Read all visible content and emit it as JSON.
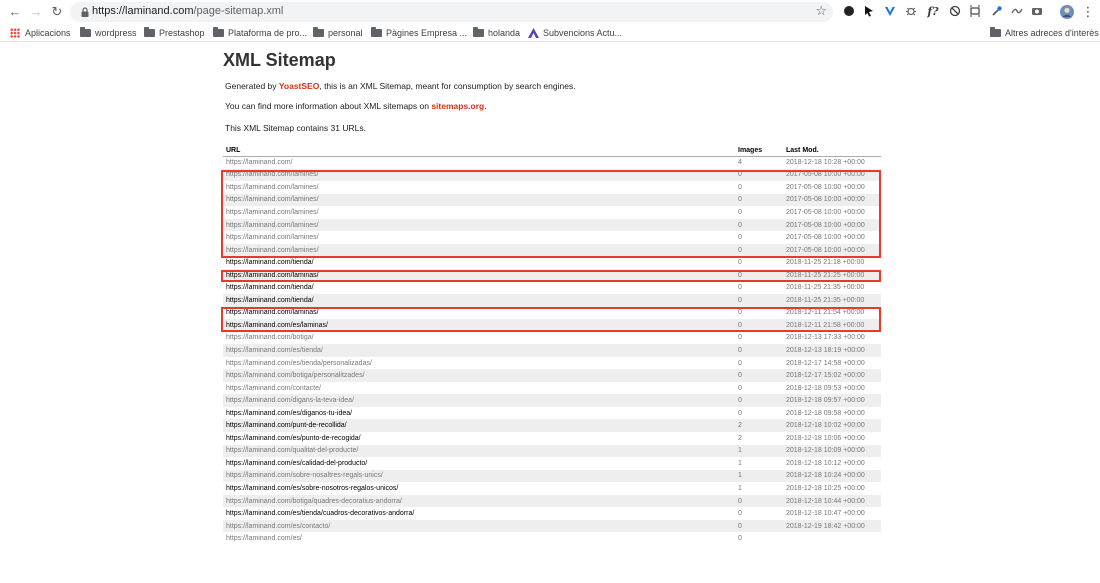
{
  "browser": {
    "url_host": "https://laminand.com",
    "url_path": "/page-sitemap.xml",
    "toolbar_icons": [
      "back-icon",
      "forward-icon",
      "reload-icon",
      "lock-icon",
      "star-icon"
    ],
    "extension_icons": [
      "circle-ext-icon",
      "pointer-ext-icon",
      "v-ext-icon",
      "bug-ext-icon",
      "fx-ext-icon",
      "block-ext-icon",
      "crop-ext-icon",
      "eyedropper-ext-icon",
      "wave-ext-icon",
      "camera-ext-icon",
      "profile-avatar",
      "menu-icon"
    ],
    "extension_labels": [
      "f?"
    ],
    "bookmarks": [
      {
        "label": "Aplicacions",
        "icon": "apps-icon"
      },
      {
        "label": "wordpress",
        "icon": "folder-icon"
      },
      {
        "label": "Prestashop",
        "icon": "folder-icon"
      },
      {
        "label": "Plataforma de pro...",
        "icon": "folder-icon"
      },
      {
        "label": "personal",
        "icon": "folder-icon"
      },
      {
        "label": "Pàgines Empresa ...",
        "icon": "folder-icon"
      },
      {
        "label": "holanda",
        "icon": "folder-icon"
      },
      {
        "label": "Subvencions Actu...",
        "icon": "logo-icon"
      }
    ],
    "other_bookmarks": "Altres adreces d'interès"
  },
  "page": {
    "title": "XML Sitemap",
    "intro_prefix": "Generated by ",
    "intro_link": "YoastSEO",
    "intro_suffix": ", this is an XML Sitemap, meant for consumption by search engines.",
    "info_prefix": "You can find more information about XML sitemaps on ",
    "info_link": "sitemaps.org",
    "info_suffix": ".",
    "count_text": "This XML Sitemap contains 31 URLs.",
    "link_color": "#da3114",
    "highlight_color": "#e8392d"
  },
  "table": {
    "headers": [
      "URL",
      "Images",
      "Last Mod."
    ],
    "rows": [
      {
        "url": "https://laminand.com/",
        "images": "4",
        "lastmod": "2018-12-18 10:28 +00:00",
        "dark": false
      },
      {
        "url": "https://laminand.com/lamines/",
        "images": "0",
        "lastmod": "2017-05-08 10:00 +00:00",
        "dark": false
      },
      {
        "url": "https://laminand.com/lamines/",
        "images": "0",
        "lastmod": "2017-05-08 10:00 +00:00",
        "dark": false
      },
      {
        "url": "https://laminand.com/lamines/",
        "images": "0",
        "lastmod": "2017-05-08 10:00 +00:00",
        "dark": false
      },
      {
        "url": "https://laminand.com/lamines/",
        "images": "0",
        "lastmod": "2017-05-08 10:00 +00:00",
        "dark": false
      },
      {
        "url": "https://laminand.com/lamines/",
        "images": "0",
        "lastmod": "2017-05-08 10:00 +00:00",
        "dark": false
      },
      {
        "url": "https://laminand.com/lamines/",
        "images": "0",
        "lastmod": "2017-05-08 10:00 +00:00",
        "dark": false
      },
      {
        "url": "https://laminand.com/lamines/",
        "images": "0",
        "lastmod": "2017-05-08 10:00 +00:00",
        "dark": false
      },
      {
        "url": "https://laminand.com/tienda/",
        "images": "0",
        "lastmod": "2018-11-25 21:18 +00:00",
        "dark": true
      },
      {
        "url": "https://laminand.com/laminas/",
        "images": "0",
        "lastmod": "2018-11-25 21:25 +00:00",
        "dark": true
      },
      {
        "url": "https://laminand.com/tienda/",
        "images": "0",
        "lastmod": "2018-11-25 21:35 +00:00",
        "dark": true
      },
      {
        "url": "https://laminand.com/tienda/",
        "images": "0",
        "lastmod": "2018-11-25 21:35 +00:00",
        "dark": true
      },
      {
        "url": "https://laminand.com/laminas/",
        "images": "0",
        "lastmod": "2018-12-11 21:54 +00:00",
        "dark": true
      },
      {
        "url": "https://laminand.com/es/laminas/",
        "images": "0",
        "lastmod": "2018-12-11 21:58 +00:00",
        "dark": true
      },
      {
        "url": "https://laminand.com/botiga/",
        "images": "0",
        "lastmod": "2018-12-13 17:33 +00:00",
        "dark": false
      },
      {
        "url": "https://laminand.com/es/tienda/",
        "images": "0",
        "lastmod": "2018-12-13 18:19 +00:00",
        "dark": false
      },
      {
        "url": "https://laminand.com/es/tienda/personalizadas/",
        "images": "0",
        "lastmod": "2018-12-17 14:58 +00:00",
        "dark": false
      },
      {
        "url": "https://laminand.com/botiga/personalitzades/",
        "images": "0",
        "lastmod": "2018-12-17 15:02 +00:00",
        "dark": false
      },
      {
        "url": "https://laminand.com/contacte/",
        "images": "0",
        "lastmod": "2018-12-18 09:53 +00:00",
        "dark": false
      },
      {
        "url": "https://laminand.com/digans-la-teva-idea/",
        "images": "0",
        "lastmod": "2018-12-18 09:57 +00:00",
        "dark": false
      },
      {
        "url": "https://laminand.com/es/diganos-tu-idea/",
        "images": "0",
        "lastmod": "2018-12-18 09:58 +00:00",
        "dark": true
      },
      {
        "url": "https://laminand.com/punt-de-recollida/",
        "images": "2",
        "lastmod": "2018-12-18 10:02 +00:00",
        "dark": true
      },
      {
        "url": "https://laminand.com/es/punto-de-recogida/",
        "images": "2",
        "lastmod": "2018-12-18 10:06 +00:00",
        "dark": true
      },
      {
        "url": "https://laminand.com/qualitat-del-producte/",
        "images": "1",
        "lastmod": "2018-12-18 10:09 +00:00",
        "dark": false
      },
      {
        "url": "https://laminand.com/es/calidad-del-producto/",
        "images": "1",
        "lastmod": "2018-12-18 10:12 +00:00",
        "dark": true
      },
      {
        "url": "https://laminand.com/sobre-nosaltres-regals-unics/",
        "images": "1",
        "lastmod": "2018-12-18 10:24 +00:00",
        "dark": false
      },
      {
        "url": "https://laminand.com/es/sobre-nosotros-regalos-unicos/",
        "images": "1",
        "lastmod": "2018-12-18 10:25 +00:00",
        "dark": true
      },
      {
        "url": "https://laminand.com/botiga/quadres-decoratius-andorra/",
        "images": "0",
        "lastmod": "2018-12-18 10:44 +00:00",
        "dark": false
      },
      {
        "url": "https://laminand.com/es/tienda/cuadros-decorativos-andorra/",
        "images": "0",
        "lastmod": "2018-12-18 10:47 +00:00",
        "dark": true
      },
      {
        "url": "https://laminand.com/es/contacto/",
        "images": "0",
        "lastmod": "2018-12-19 18:42 +00:00",
        "dark": false
      },
      {
        "url": "https://laminand.com/es/",
        "images": "0",
        "lastmod": "",
        "dark": false
      }
    ]
  }
}
